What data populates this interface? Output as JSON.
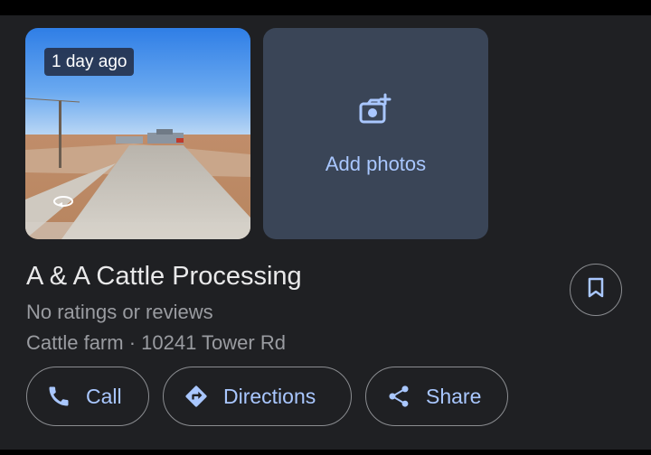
{
  "photo": {
    "time_badge": "1 day ago"
  },
  "add_photos": {
    "label": "Add photos"
  },
  "place": {
    "name": "A & A Cattle Processing",
    "ratings": "No ratings or reviews",
    "category_address": "Cattle farm · 10241 Tower Rd"
  },
  "actions": {
    "call": "Call",
    "directions": "Directions",
    "share": "Share"
  },
  "colors": {
    "background": "#1f2023",
    "accent": "#a9c7ff",
    "add_photos_tile": "#3a4557",
    "secondary_text": "#9a9ca1"
  },
  "icons": [
    "street-view-rotate-icon",
    "add-photo-icon",
    "bookmark-icon",
    "phone-icon",
    "directions-icon",
    "share-icon"
  ]
}
